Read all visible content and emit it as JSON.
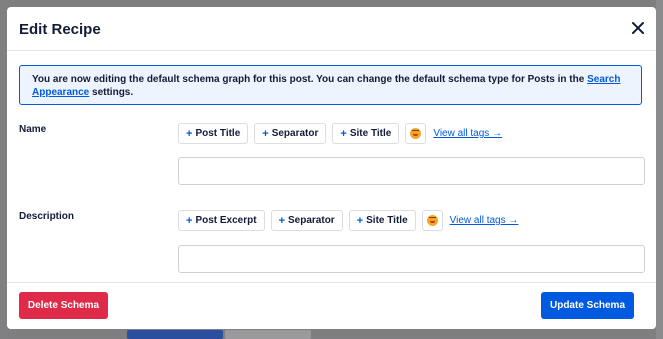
{
  "modal": {
    "title": "Edit Recipe",
    "close_icon": "close-icon"
  },
  "notice": {
    "text": "You are now editing the default schema graph for this post. You can change the default schema type for Posts in the ",
    "link": "Search Appearance",
    "suffix": " settings."
  },
  "fields": [
    {
      "label": "Name",
      "tags": [
        "Post Title",
        "Separator",
        "Site Title"
      ],
      "emoji_icon": "emoji-icon",
      "view_all": "View all tags →",
      "value": ""
    },
    {
      "label": "Description",
      "tags": [
        "Post Excerpt",
        "Separator",
        "Site Title"
      ],
      "emoji_icon": "emoji-icon",
      "view_all": "View all tags →",
      "value": ""
    }
  ],
  "tag_prefix": "+",
  "footer": {
    "delete_label": "Delete Schema",
    "update_label": "Update Schema"
  },
  "colors": {
    "accent": "#005ae0",
    "danger": "#df2a4a",
    "text": "#141b38",
    "notice_bg": "#edf4fd"
  }
}
